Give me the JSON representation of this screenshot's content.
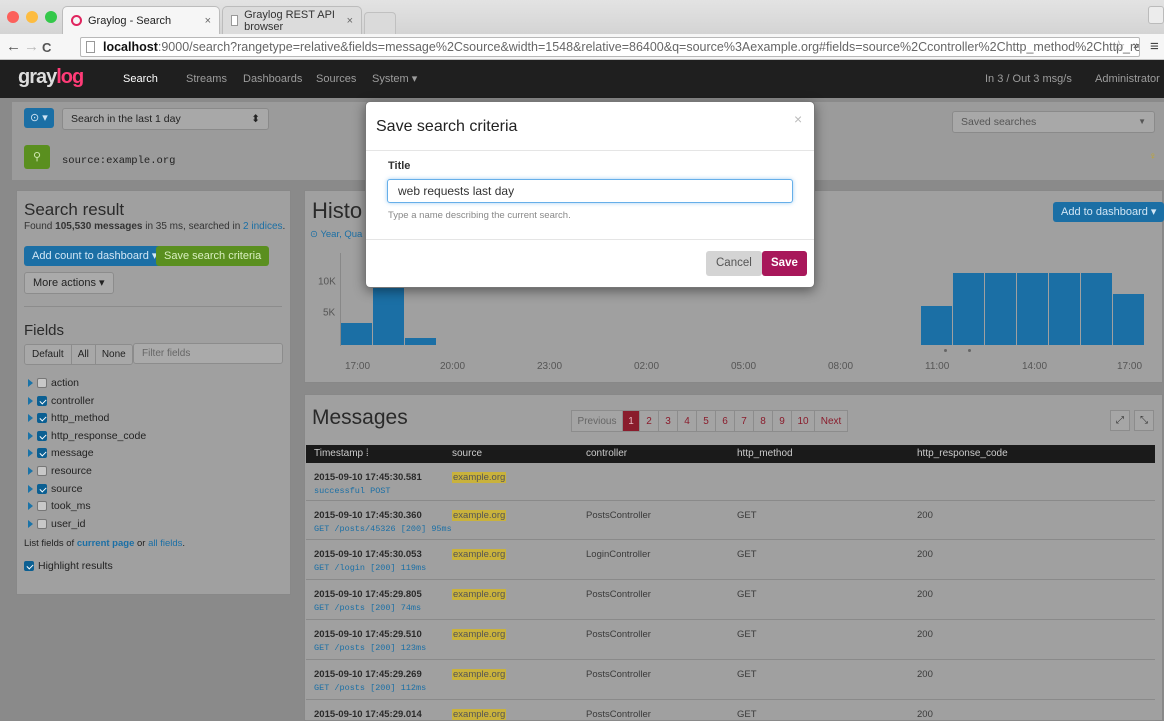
{
  "browser": {
    "tabs": [
      {
        "label": "Graylog - Search",
        "close": "×"
      },
      {
        "label": "Graylog REST API browser",
        "close": "×"
      }
    ],
    "url_host": "localhost",
    "url_rest": ":9000/search?rangetype=relative&fields=message%2Csource&width=1548&relative=86400&q=source%3Aexample.org#fields=source%2Ccontroller%2Chttp_method%2Chttp_response_code%…"
  },
  "nav": {
    "logo_a": "gray",
    "logo_b": "log",
    "items": [
      "Search",
      "Streams",
      "Dashboards",
      "Sources",
      "System ▾"
    ],
    "throughput": "In 3 / Out 3 msg/s",
    "user": "Administrator ▾"
  },
  "search": {
    "range": "Search in the last 1 day",
    "query": "source:example.org",
    "saved_searches": "Saved searches"
  },
  "result": {
    "title": "Search result",
    "summary_pre": "Found ",
    "summary_count": "105,530 messages",
    "summary_mid": " in 35 ms, searched in ",
    "summary_link": "2 indices",
    "summary_post": ".",
    "add_count": "Add count to dashboard ▾",
    "save_criteria": "Save search criteria",
    "more_actions": "More actions ▾"
  },
  "fields": {
    "title": "Fields",
    "tabs": [
      "Default",
      "All",
      "None"
    ],
    "filter_placeholder": "Filter fields",
    "items": [
      {
        "name": "action",
        "checked": false
      },
      {
        "name": "controller",
        "checked": true
      },
      {
        "name": "http_method",
        "checked": true
      },
      {
        "name": "http_response_code",
        "checked": true
      },
      {
        "name": "message",
        "checked": true
      },
      {
        "name": "resource",
        "checked": false
      },
      {
        "name": "source",
        "checked": true
      },
      {
        "name": "took_ms",
        "checked": false
      },
      {
        "name": "user_id",
        "checked": false
      }
    ],
    "list_pre": "List fields of ",
    "list_link1": "current page",
    "list_mid": " or ",
    "list_link2": "all fields",
    "list_post": ".",
    "highlight": "Highlight results"
  },
  "histogram": {
    "title": "Histo",
    "subtitle": "Year, Qua",
    "add_to_dashboard": "Add to dashboard ▾"
  },
  "chart_data": {
    "type": "bar",
    "x_ticks": [
      "17:00",
      "20:00",
      "23:00",
      "02:00",
      "05:00",
      "08:00",
      "11:00",
      "14:00",
      "17:00"
    ],
    "y_ticks": [
      "5K",
      "10K"
    ],
    "categories": [
      "16:00",
      "17:00",
      "18:00",
      "11:00",
      "12:00",
      "13:00",
      "14:00",
      "15:00",
      "16:00",
      "17:00"
    ],
    "values": [
      3300,
      13200,
      1000,
      5700,
      10500,
      10500,
      10500,
      10500,
      10500,
      7500
    ],
    "ylim": [
      0,
      13500
    ]
  },
  "messages": {
    "title": "Messages",
    "pagination": [
      "Previous",
      "1",
      "2",
      "3",
      "4",
      "5",
      "6",
      "7",
      "8",
      "9",
      "10",
      "Next"
    ],
    "columns": [
      "Timestamp ⁞",
      "source",
      "controller",
      "http_method",
      "http_response_code"
    ],
    "rows": [
      {
        "ts": "2015-09-10 17:45:30.581",
        "msg": "successful POST",
        "source": "example.org",
        "controller": "",
        "method": "",
        "code": ""
      },
      {
        "ts": "2015-09-10 17:45:30.360",
        "msg": "GET /posts/45326 [200] 95ms",
        "source": "example.org",
        "controller": "PostsController",
        "method": "GET",
        "code": "200"
      },
      {
        "ts": "2015-09-10 17:45:30.053",
        "msg": "GET /login [200] 119ms",
        "source": "example.org",
        "controller": "LoginController",
        "method": "GET",
        "code": "200"
      },
      {
        "ts": "2015-09-10 17:45:29.805",
        "msg": "GET /posts [200] 74ms",
        "source": "example.org",
        "controller": "PostsController",
        "method": "GET",
        "code": "200"
      },
      {
        "ts": "2015-09-10 17:45:29.510",
        "msg": "GET /posts [200] 123ms",
        "source": "example.org",
        "controller": "PostsController",
        "method": "GET",
        "code": "200"
      },
      {
        "ts": "2015-09-10 17:45:29.269",
        "msg": "GET /posts [200] 112ms",
        "source": "example.org",
        "controller": "PostsController",
        "method": "GET",
        "code": "200"
      },
      {
        "ts": "2015-09-10 17:45:29.014",
        "msg": "",
        "source": "example.org",
        "controller": "PostsController",
        "method": "GET",
        "code": "200"
      }
    ]
  },
  "modal": {
    "title": "Save search criteria",
    "close": "×",
    "field_label": "Title",
    "value": "web requests last day",
    "help": "Type a name describing the current search.",
    "cancel": "Cancel",
    "save": "Save"
  },
  "colors": {
    "accent": "#1b6fa5",
    "brand": "#ff3b77",
    "save": "#a8175a",
    "green": "#5a8f1f"
  }
}
